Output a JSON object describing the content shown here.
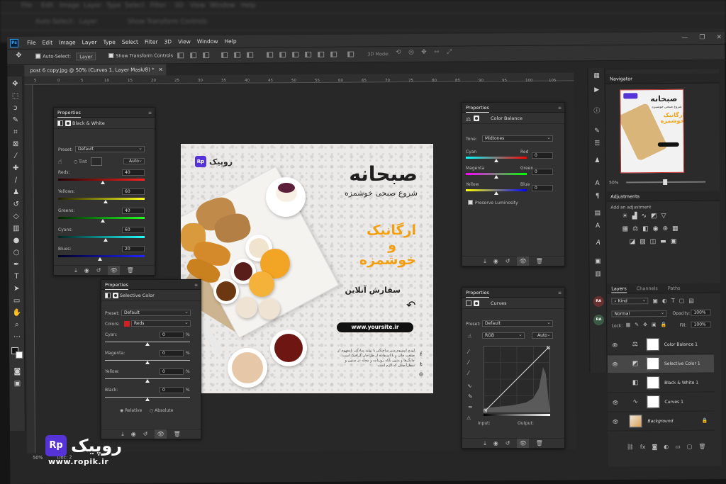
{
  "app": {
    "menu": [
      "File",
      "Edit",
      "Image",
      "Layer",
      "Type",
      "Select",
      "Filter",
      "3D",
      "View",
      "Window",
      "Help"
    ],
    "options": {
      "auto_select": "Auto-Select:",
      "layer_dd": "Layer",
      "transform": "Show Transform Controls",
      "mode_3d": "3D Mode:"
    },
    "doc_tab": "post 6 copy.jpg @ 50% (Curves 1, Layer Mask/8) *",
    "ruler_ticks": [
      "5",
      "0",
      "5",
      "10",
      "15",
      "20",
      "25",
      "30",
      "35",
      "40",
      "45",
      "50",
      "55",
      "60",
      "65",
      "70",
      "75",
      "80",
      "85",
      "90",
      "95",
      "100",
      "105"
    ],
    "status_zoom": "50%",
    "status_doc": "Doc: 2",
    "window_controls": [
      "—",
      "❐",
      "✕"
    ]
  },
  "bg_menu": [
    "File",
    "Edit",
    "Image",
    "Layer",
    "Type",
    "Select",
    "Filter",
    "3D",
    "View",
    "Window",
    "Help"
  ],
  "bg_opts": [
    "Auto-Select:",
    "Layer",
    "Show Transform Controls"
  ],
  "panels": {
    "bw": {
      "tab": "Properties",
      "title": "Black & White",
      "preset_label": "Preset:",
      "preset": "Default",
      "tint": "Tint",
      "auto": "Auto",
      "channels": [
        {
          "label": "Reds:",
          "value": "40"
        },
        {
          "label": "Yellows:",
          "value": "60"
        },
        {
          "label": "Greens:",
          "value": "40"
        },
        {
          "label": "Cyans:",
          "value": "60"
        },
        {
          "label": "Blues:",
          "value": "20"
        }
      ]
    },
    "selective": {
      "tab": "Properties",
      "title": "Selective Color",
      "preset_label": "Preset:",
      "preset": "Default",
      "colors_label": "Colors:",
      "colors": "Reds",
      "sliders": [
        {
          "label": "Cyan:",
          "value": "0",
          "unit": "%"
        },
        {
          "label": "Magenta:",
          "value": "0",
          "unit": "%"
        },
        {
          "label": "Yellow:",
          "value": "0",
          "unit": "%"
        },
        {
          "label": "Black:",
          "value": "0",
          "unit": "%"
        }
      ],
      "relative": "Relative",
      "absolute": "Absolute"
    },
    "color_balance": {
      "tab": "Properties",
      "title": "Color Balance",
      "tone_label": "Tone:",
      "tone": "Midtones",
      "rows": [
        {
          "left": "Cyan",
          "right": "Red",
          "value": "0"
        },
        {
          "left": "Magenta",
          "right": "Green",
          "value": "0"
        },
        {
          "left": "Yellow",
          "right": "Blue",
          "value": "0"
        }
      ],
      "preserve": "Preserve Luminosity"
    },
    "curves": {
      "tab": "Properties",
      "title": "Curves",
      "preset_label": "Preset:",
      "preset": "Default",
      "channel": "RGB",
      "auto": "Auto",
      "input": "Input:",
      "output": "Output:"
    }
  },
  "right": {
    "navigator": "Navigator",
    "nav_zoom": "50%",
    "adjustments": "Adjustments",
    "add_adj": "Add an adjustment",
    "tabs": [
      "Layers",
      "Channels",
      "Paths"
    ],
    "kind": "Kind",
    "blend": "Normal",
    "opacity_label": "Opacity:",
    "opacity": "100%",
    "lock_label": "Lock:",
    "fill_label": "Fill:",
    "fill": "100%",
    "layers": [
      {
        "name": "Color Balance 1",
        "visible": true,
        "selected": false,
        "icon": "⚖"
      },
      {
        "name": "Selective Color 1",
        "visible": true,
        "selected": true,
        "icon": "◩"
      },
      {
        "name": "Black & White 1",
        "visible": false,
        "selected": false,
        "icon": "◧"
      },
      {
        "name": "Curves 1",
        "visible": true,
        "selected": false,
        "icon": "∿"
      },
      {
        "name": "Background",
        "visible": true,
        "selected": false,
        "icon": "img"
      }
    ],
    "dock_badges": [
      "RA",
      "RA"
    ]
  },
  "poster": {
    "logo_rp": "Rp",
    "logo_name": "روپیک",
    "title": "صبحانه",
    "subtitle": "شروع صبحی خوشمزه",
    "org_lines": [
      "ارگانیک",
      "و",
      "خوشمزه"
    ],
    "order": "سفارش آنلاین",
    "site": "www.yoursite.ir",
    "para": "لورم ایپسوم متن ساختگی با تولید سادگی نامفهوم از صنعت چاپ و با استفاده از طراحان گرافیک است چاپگرها و متون بلکه روزنامه و مجله در ستون و سطرآنچنان که لازم است",
    "social": [
      "f",
      "t",
      "◎"
    ]
  },
  "watermark": {
    "rp": "Rp",
    "name": "روپیک",
    "site": "www.ropik.ir"
  }
}
